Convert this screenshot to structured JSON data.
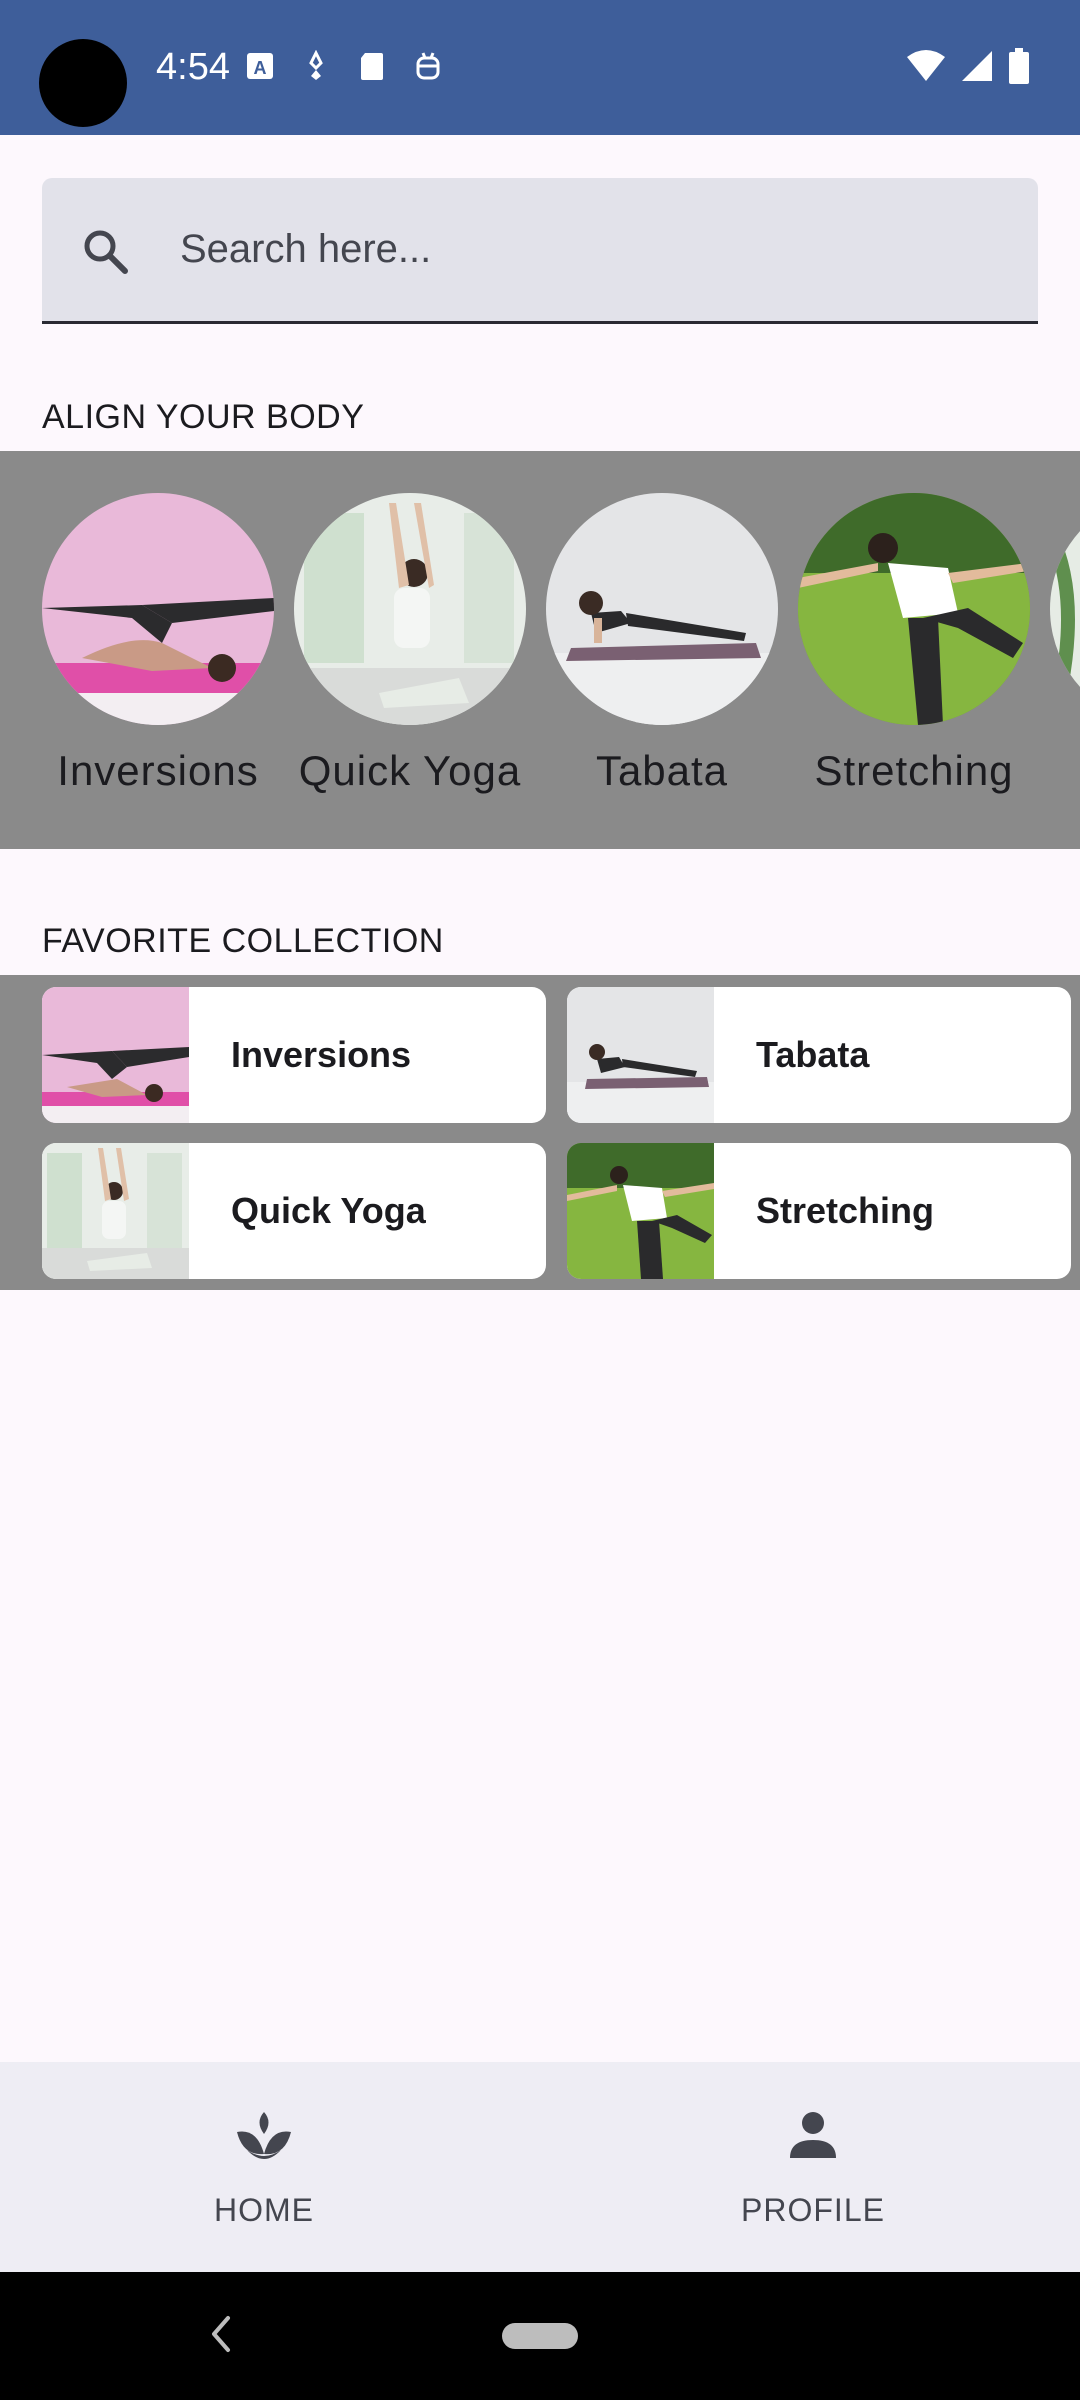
{
  "status_bar": {
    "time": "4:54",
    "left_icons": [
      "text-a-icon",
      "sparkle-icon",
      "sd-card-icon",
      "robot-icon"
    ],
    "right_icons": [
      "wifi-icon",
      "signal-icon",
      "battery-icon"
    ]
  },
  "search": {
    "placeholder": "Search here..."
  },
  "align_section": {
    "title": "ALIGN YOUR BODY",
    "items": [
      {
        "label": "Inversions"
      },
      {
        "label": "Quick Yoga"
      },
      {
        "label": "Tabata"
      },
      {
        "label": "Stretching"
      }
    ]
  },
  "favorites_section": {
    "title": "FAVORITE COLLECTION",
    "items": [
      {
        "label": "Inversions"
      },
      {
        "label": "Tabata"
      },
      {
        "label": "Quick Yoga"
      },
      {
        "label": "Stretching"
      }
    ]
  },
  "bottom_nav": {
    "items": [
      {
        "label": "HOME",
        "icon": "lotus-icon"
      },
      {
        "label": "PROFILE",
        "icon": "person-icon"
      }
    ]
  },
  "colors": {
    "status_bar": "#3e5e9a",
    "background": "#fdf8fd",
    "search_bg": "#e2e2ea",
    "strip_bg": "#8a8a8a",
    "nav_bg": "#eeedf4"
  }
}
